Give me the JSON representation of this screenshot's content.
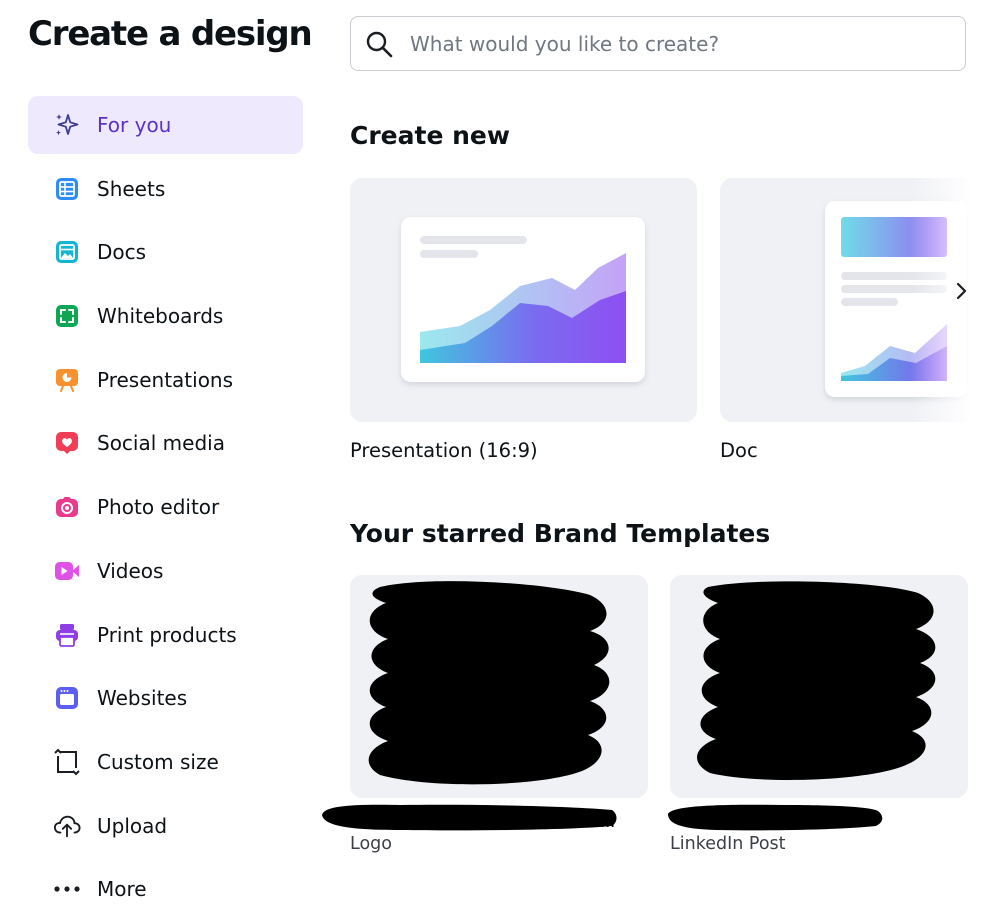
{
  "page": {
    "title": "Create a design"
  },
  "search": {
    "placeholder": "What would you like to create?",
    "value": ""
  },
  "sidebar": {
    "items": [
      {
        "label": "For you",
        "icon": "sparkle-icon",
        "active": true
      },
      {
        "label": "Sheets",
        "icon": "sheets-icon"
      },
      {
        "label": "Docs",
        "icon": "docs-icon"
      },
      {
        "label": "Whiteboards",
        "icon": "whiteboard-icon"
      },
      {
        "label": "Presentations",
        "icon": "presentation-icon"
      },
      {
        "label": "Social media",
        "icon": "heart-icon"
      },
      {
        "label": "Photo editor",
        "icon": "camera-icon"
      },
      {
        "label": "Videos",
        "icon": "video-icon"
      },
      {
        "label": "Print products",
        "icon": "printer-icon"
      },
      {
        "label": "Websites",
        "icon": "website-icon"
      },
      {
        "label": "Custom size",
        "icon": "resize-icon"
      },
      {
        "label": "Upload",
        "icon": "upload-cloud-icon"
      },
      {
        "label": "More",
        "icon": "more-icon"
      }
    ]
  },
  "create_new": {
    "title": "Create new",
    "cards": [
      {
        "label": "Presentation (16:9)"
      },
      {
        "label": "Doc"
      }
    ]
  },
  "brand_templates": {
    "title": "Your starred Brand Templates",
    "items": [
      {
        "type": "Logo"
      },
      {
        "type": "LinkedIn Post"
      }
    ]
  },
  "colors": {
    "accent_purple": "#5a32c6",
    "active_bg": "#efe9fe",
    "card_bg": "#f0f1f5"
  }
}
